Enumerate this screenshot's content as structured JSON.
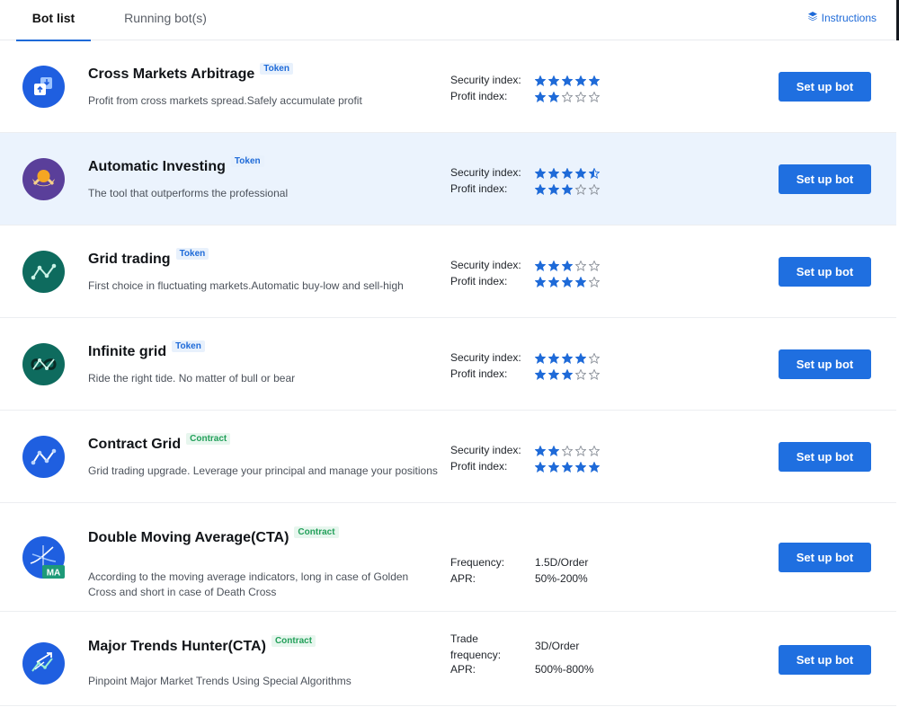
{
  "colors": {
    "accent": "#1e6ad8",
    "token_badge": "#1e6ad8",
    "contract_badge": "#23a05a",
    "highlight_row": "#ebf3fd"
  },
  "tabs": [
    {
      "label": "Bot list",
      "active": true
    },
    {
      "label": "Running bot(s)",
      "active": false
    }
  ],
  "instructions": {
    "label": "Instructions",
    "icon": "layers-icon"
  },
  "bots": [
    {
      "name": "Cross Markets Arbitrage",
      "badge": "Token",
      "desc": "Profit from cross markets spread.Safely accumulate profit",
      "icon": "arbitrage-icon",
      "security_label": "Security index:",
      "profit_label": "Profit index:",
      "security": 5,
      "profit": 2,
      "button": "Set up bot"
    },
    {
      "name": "Automatic Investing",
      "badge": "Token",
      "desc": "The tool that outperforms the professional",
      "icon": "investing-icon",
      "security_label": "Security index:",
      "profit_label": "Profit index:",
      "security": 4.5,
      "profit": 3,
      "button": "Set up bot"
    },
    {
      "name": "Grid trading",
      "badge": "Token",
      "desc": "First choice in fluctuating markets.Automatic buy-low and sell-high",
      "icon": "grid-trading-icon",
      "security_label": "Security index:",
      "profit_label": "Profit index:",
      "security": 3,
      "profit": 4,
      "button": "Set up bot"
    },
    {
      "name": "Infinite grid",
      "badge": "Token",
      "desc": "Ride the right tide. No matter of bull or bear",
      "icon": "infinite-grid-icon",
      "security_label": "Security index:",
      "profit_label": "Profit index:",
      "security": 4,
      "profit": 3,
      "button": "Set up bot"
    },
    {
      "name": "Contract Grid",
      "badge": "Contract",
      "desc": "Grid trading upgrade. Leverage your principal and manage your positions",
      "icon": "contract-grid-icon",
      "security_label": "Security index:",
      "profit_label": "Profit index:",
      "security": 2,
      "profit": 5,
      "button": "Set up bot"
    },
    {
      "name": "Double Moving Average(CTA)",
      "badge": "Contract",
      "desc": "According to the moving average indicators, long in case of Golden Cross and short in case of Death Cross",
      "icon": "moving-average-icon",
      "freq_label": "Frequency:",
      "freq": "1.5D/Order",
      "apr_label": "APR:",
      "apr": "50%-200%",
      "button": "Set up bot"
    },
    {
      "name": "Major Trends Hunter(CTA)",
      "badge": "Contract",
      "desc": "Pinpoint Major Market Trends Using Special Algorithms",
      "icon": "trend-hunter-icon",
      "freq_label": "Trade frequency:",
      "freq": "3D/Order",
      "apr_label": "APR:",
      "apr": "500%-800%",
      "button": "Set up bot"
    }
  ]
}
